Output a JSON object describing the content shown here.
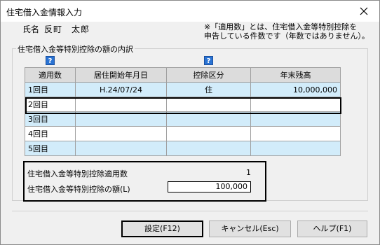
{
  "window": {
    "title": "住宅借入金情報入力",
    "close_label": "✕"
  },
  "person": {
    "name_label": "氏名",
    "name_value": "反町　太郎"
  },
  "note": "※「適用数」とは、住宅借入金等特別控除を\n申告している件数です（年数ではありません）。",
  "group": {
    "label": "住宅借入金等特別控除の額の内訳",
    "help_icon_text": "?"
  },
  "table": {
    "headers": [
      "適用数",
      "居住開始年月日",
      "控除区分",
      "年末残高"
    ],
    "rows": [
      {
        "label": "1回目",
        "start_date": "H.24/07/24",
        "category": "住",
        "balance": "10,000,000"
      },
      {
        "label": "2回目",
        "start_date": "",
        "category": "",
        "balance": ""
      },
      {
        "label": "3回目",
        "start_date": "",
        "category": "",
        "balance": ""
      },
      {
        "label": "4回目",
        "start_date": "",
        "category": "",
        "balance": ""
      },
      {
        "label": "5回目",
        "start_date": "",
        "category": "",
        "balance": ""
      }
    ]
  },
  "summary": {
    "count_label": "住宅借入金等特別控除適用数",
    "count_value": "1",
    "amount_label": "住宅借入金等特別控除の額(L)",
    "amount_value": "100,000"
  },
  "buttons": {
    "ok": "設定(F12)",
    "cancel": "キャンセル(Esc)",
    "help": "ヘルプ(F1)"
  },
  "colors": {
    "row_highlight": "#d2ecfa",
    "help_icon": "#2a73d3"
  }
}
